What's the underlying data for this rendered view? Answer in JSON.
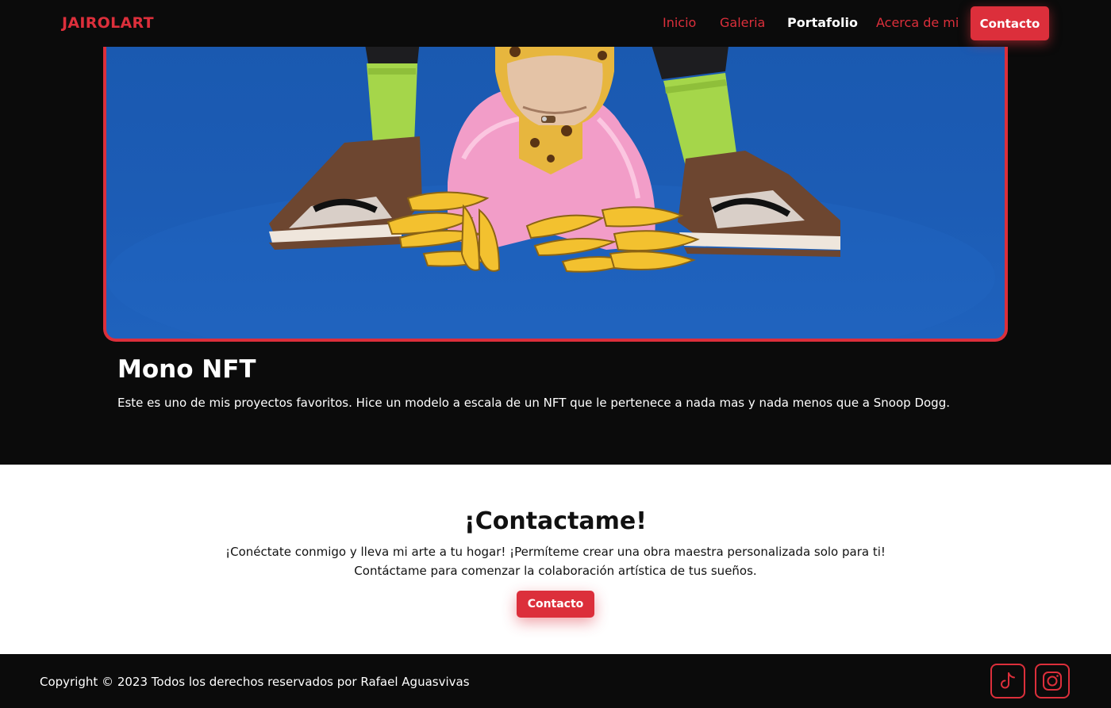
{
  "navbar": {
    "brand": "JAIROLART",
    "links": [
      {
        "label": "Inicio",
        "active": false
      },
      {
        "label": "Galeria",
        "active": false
      },
      {
        "label": "Portafolio",
        "active": true
      },
      {
        "label": "Acerca de mi",
        "active": false
      }
    ],
    "cta_label": "Contacto"
  },
  "project": {
    "title": "Mono NFT",
    "description": "Este es uno de mis proyectos favoritos. Hice un modelo a escala de un NFT que le pertenece a nada mas y nada menos que a Snoop Dogg."
  },
  "contact": {
    "title": "¡Contactame!",
    "line1": "¡Conéctate conmigo y lleva mi arte a tu hogar! ¡Permíteme crear una obra maestra personalizada solo para ti!",
    "line2": "Contáctame para comenzar la colaboración artística de tus sueños.",
    "cta_label": "Contacto"
  },
  "footer": {
    "copyright": "Copyright © 2023 Todos los derechos reservados por Rafael Aguasvivas",
    "social": [
      "tiktok-icon",
      "instagram-icon"
    ]
  },
  "colors": {
    "accent": "#dc2f3b",
    "background": "#0b0b0b",
    "photo_backdrop": "#1c5cb5"
  }
}
